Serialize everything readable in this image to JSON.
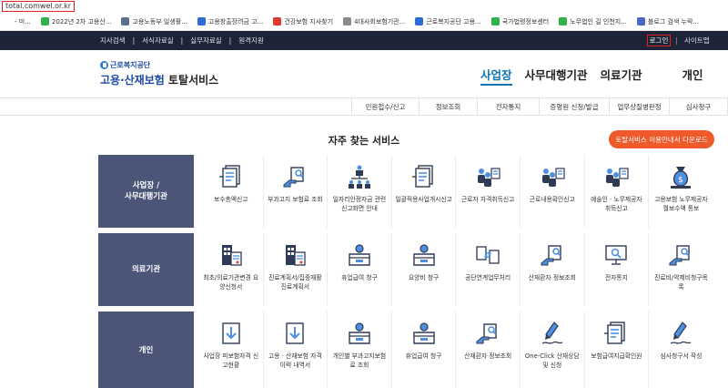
{
  "browser": {
    "url": "total.comwel.or.kr",
    "bookmarks": [
      {
        "label": "- 미...",
        "color": "#ffffff"
      },
      {
        "label": "2022년 2차 고용산...",
        "color": "#2fb34a"
      },
      {
        "label": "고용노동부 일생활...",
        "color": "#5a6f8d"
      },
      {
        "label": "고용창출장려금 고...",
        "color": "#2e6bd6"
      },
      {
        "label": "건강보험 지사찾기",
        "color": "#e03a2e"
      },
      {
        "label": "4대사회보험기관...",
        "color": "#8a8a8a"
      },
      {
        "label": "근로복지공단 고용...",
        "color": "#2e6bd6"
      },
      {
        "label": "국가법령정보센터",
        "color": "#2fb34a"
      },
      {
        "label": "노무법인 길 인천지...",
        "color": "#2fb34a"
      },
      {
        "label": "블로그 검색 누락...",
        "color": "#4a69c6"
      }
    ]
  },
  "topnav": {
    "links": [
      "지사검색",
      "서식자료실",
      "실무자료실",
      "원격지원"
    ],
    "login": "로그인",
    "sitemap": "사이트맵"
  },
  "logo": {
    "org": "근로복지공단",
    "title_part1": "고용·산재보험",
    "title_part2": " 토탈서비스"
  },
  "main_tabs": [
    "사업장",
    "사무대행기관",
    "의료기관",
    "개인"
  ],
  "submenu": [
    "민원접수/신고",
    "정보조회",
    "전자통지",
    "증명원 신청/발급",
    "업무상질병판정",
    "심사청구"
  ],
  "section": {
    "title": "자주 찾는 서비스",
    "download_button": "토탈서비스 이용안내서 다운로드"
  },
  "services": [
    {
      "category": "사업장 /\n사무대행기관",
      "items": [
        {
          "label": "보수총액신고",
          "icon": "document-list-icon"
        },
        {
          "label": "부과고지 보험료 조회",
          "icon": "hand-search-icon"
        },
        {
          "label": "일자리안정자금 관련 신고화면 안내",
          "icon": "organization-chart-icon"
        },
        {
          "label": "일괄적용사업개시신고",
          "icon": "document-list-icon"
        },
        {
          "label": "근로자 자격취득신고",
          "icon": "people-register-icon"
        },
        {
          "label": "근로내용확인신고",
          "icon": "people-register-icon"
        },
        {
          "label": "예술인 · 노무제공자 취득신고",
          "icon": "people-register-icon"
        },
        {
          "label": "고용보험 노무제공자 월보수액 통보",
          "icon": "money-bag-icon"
        }
      ]
    },
    {
      "category": "의료기관",
      "items": [
        {
          "label": "최초/의료기관변경 요양신청서",
          "icon": "building-form-icon"
        },
        {
          "label": "진료계획서/집중재활진료계획서",
          "icon": "building-form-icon"
        },
        {
          "label": "휴업급여 청구",
          "icon": "coin-box-icon"
        },
        {
          "label": "요양비 청구",
          "icon": "coin-box-icon"
        },
        {
          "label": "공단연계업무처리",
          "icon": "document-exchange-icon"
        },
        {
          "label": "산재환자 정보조회",
          "icon": "hand-search-icon"
        },
        {
          "label": "전자통지",
          "icon": "monitor-search-icon"
        },
        {
          "label": "진료비/약제비청구목록",
          "icon": "hand-search-icon"
        }
      ]
    },
    {
      "category": "개인",
      "items": [
        {
          "label": "사업장 피보험자격 신고현황",
          "icon": "download-document-icon"
        },
        {
          "label": "고용 · 산재보험 자격 이력 내역서",
          "icon": "download-document-icon"
        },
        {
          "label": "개인별 부과고지보험료 조회",
          "icon": "coin-box-icon"
        },
        {
          "label": "휴업급여 청구",
          "icon": "coin-box-icon"
        },
        {
          "label": "산재환자 정보조회",
          "icon": "hand-search-icon"
        },
        {
          "label": "One-Click 산재상담 및 신청",
          "icon": "pen-sign-icon"
        },
        {
          "label": "보험급여지급확인원",
          "icon": "document-list-icon"
        },
        {
          "label": "심사청구서 작성",
          "icon": "pen-sign-icon"
        }
      ]
    }
  ],
  "colors": {
    "topnav_bg": "#1d2438",
    "category_bg": "#4a5578",
    "accent": "#0e74b8",
    "download_button": "#ef5a2a",
    "icon_dark": "#2f3a55",
    "icon_blue": "#4f8fe0"
  }
}
